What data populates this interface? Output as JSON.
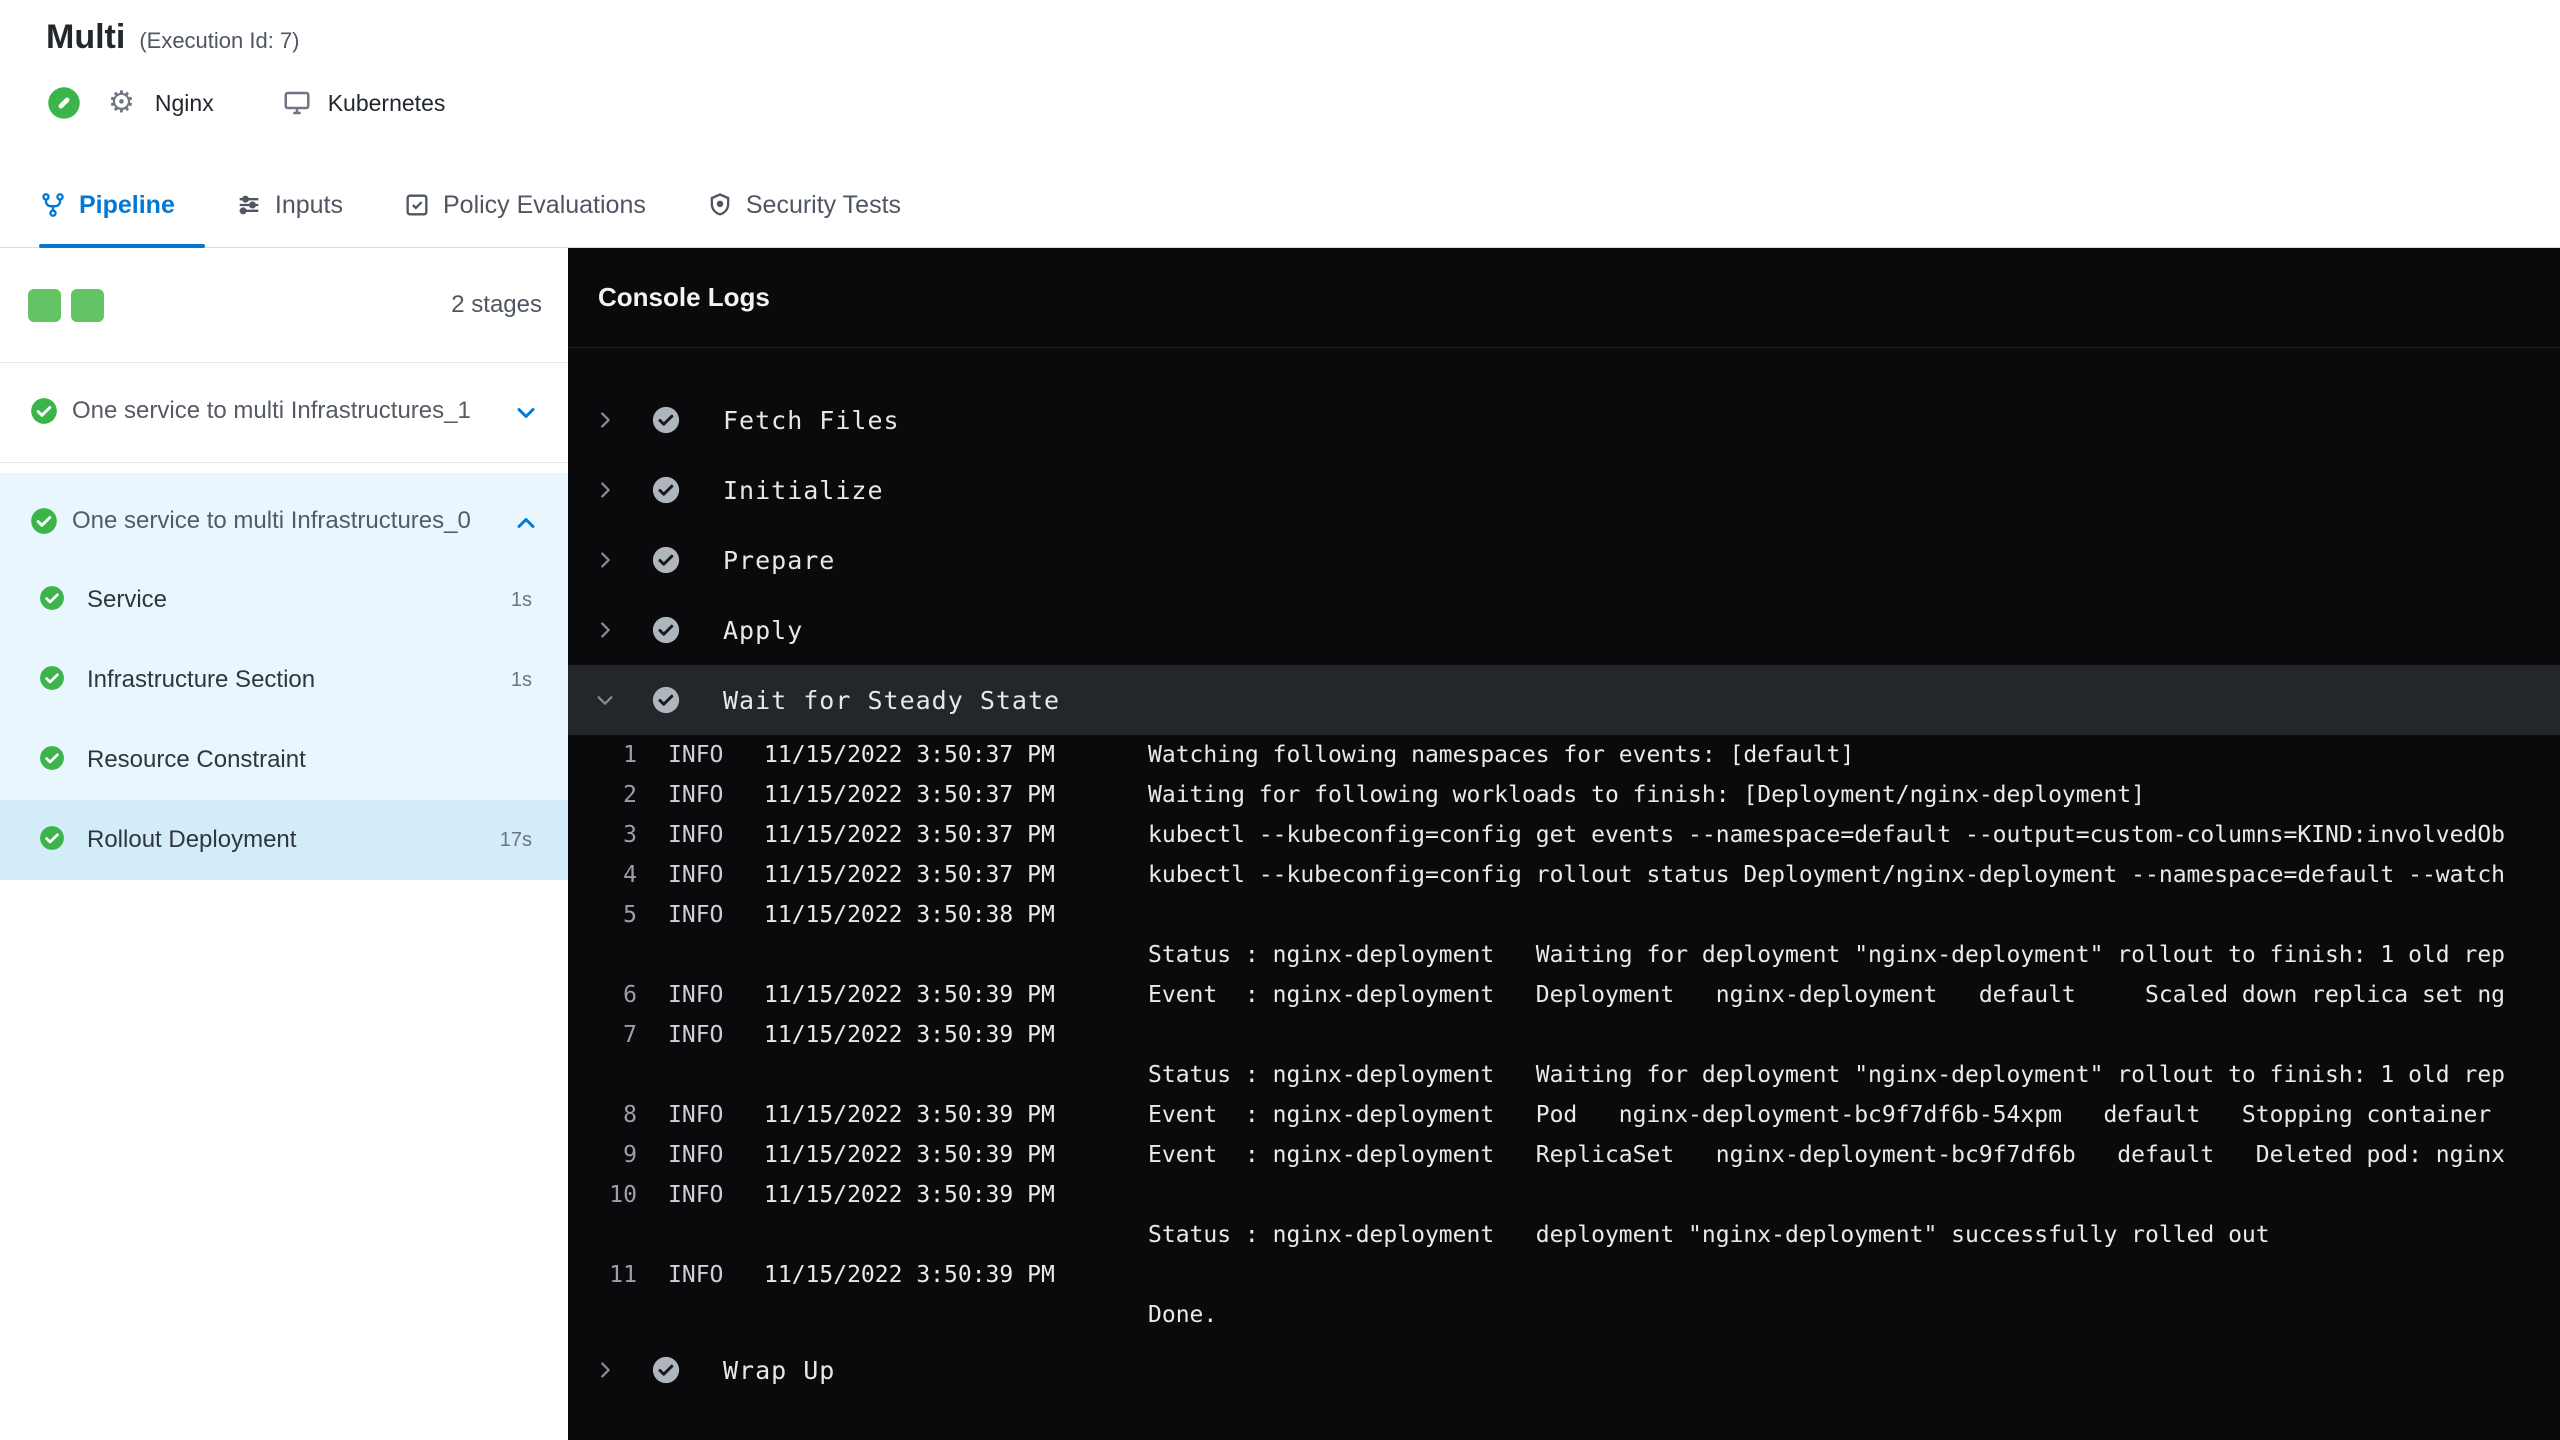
{
  "header": {
    "title": "Multi",
    "execution_id": "(Execution Id: 7)",
    "service_name": "Nginx",
    "infra_name": "Kubernetes"
  },
  "tabs": {
    "pipeline": "Pipeline",
    "inputs": "Inputs",
    "policy": "Policy Evaluations",
    "security": "Security Tests"
  },
  "sidebar": {
    "stage_count": "2 stages",
    "stage1": {
      "label": "One service to multi Infrastructures_1"
    },
    "stage2": {
      "label": "One service to multi Infrastructures_0",
      "steps": [
        {
          "label": "Service",
          "duration": "1s"
        },
        {
          "label": "Infrastructure Section",
          "duration": "1s"
        },
        {
          "label": "Resource Constraint",
          "duration": ""
        },
        {
          "label": "Rollout Deployment",
          "duration": "17s"
        }
      ]
    }
  },
  "console": {
    "title": "Console Logs",
    "steps": [
      {
        "label": "Fetch Files"
      },
      {
        "label": "Initialize"
      },
      {
        "label": "Prepare"
      },
      {
        "label": "Apply"
      }
    ],
    "expanded_step": {
      "label": "Wait for Steady State"
    },
    "last_step": {
      "label": "Wrap Up"
    },
    "logs": [
      {
        "num": "1",
        "level": "INFO",
        "time": "11/15/2022 3:50:37 PM",
        "text": "Watching following namespaces for events: [default]"
      },
      {
        "num": "2",
        "level": "INFO",
        "time": "11/15/2022 3:50:37 PM",
        "text": "Waiting for following workloads to finish: [Deployment/nginx-deployment]"
      },
      {
        "num": "3",
        "level": "INFO",
        "time": "11/15/2022 3:50:37 PM",
        "text": "kubectl --kubeconfig=config get events --namespace=default --output=custom-columns=KIND:involvedOb"
      },
      {
        "num": "4",
        "level": "INFO",
        "time": "11/15/2022 3:50:37 PM",
        "text": "kubectl --kubeconfig=config rollout status Deployment/nginx-deployment --namespace=default --watch"
      },
      {
        "num": "5",
        "level": "INFO",
        "time": "11/15/2022 3:50:38 PM",
        "text": ""
      },
      {
        "num": "",
        "level": "",
        "time": "",
        "text": "Status : nginx-deployment   Waiting for deployment \"nginx-deployment\" rollout to finish: 1 old rep"
      },
      {
        "num": "6",
        "level": "INFO",
        "time": "11/15/2022 3:50:39 PM",
        "text": "Event  : nginx-deployment   Deployment   nginx-deployment   default     Scaled down replica set ng"
      },
      {
        "num": "7",
        "level": "INFO",
        "time": "11/15/2022 3:50:39 PM",
        "text": ""
      },
      {
        "num": "",
        "level": "",
        "time": "",
        "text": "Status : nginx-deployment   Waiting for deployment \"nginx-deployment\" rollout to finish: 1 old rep"
      },
      {
        "num": "8",
        "level": "INFO",
        "time": "11/15/2022 3:50:39 PM",
        "text": "Event  : nginx-deployment   Pod   nginx-deployment-bc9f7df6b-54xpm   default   Stopping container"
      },
      {
        "num": "9",
        "level": "INFO",
        "time": "11/15/2022 3:50:39 PM",
        "text": "Event  : nginx-deployment   ReplicaSet   nginx-deployment-bc9f7df6b   default   Deleted pod: nginx"
      },
      {
        "num": "10",
        "level": "INFO",
        "time": "11/15/2022 3:50:39 PM",
        "text": ""
      },
      {
        "num": "",
        "level": "",
        "time": "",
        "text": "Status : nginx-deployment   deployment \"nginx-deployment\" successfully rolled out"
      },
      {
        "num": "11",
        "level": "INFO",
        "time": "11/15/2022 3:50:39 PM",
        "text": ""
      },
      {
        "num": "",
        "level": "",
        "time": "",
        "text": "Done."
      }
    ]
  },
  "colors": {
    "accent": "#0278D5",
    "green": "#3BB54A"
  }
}
